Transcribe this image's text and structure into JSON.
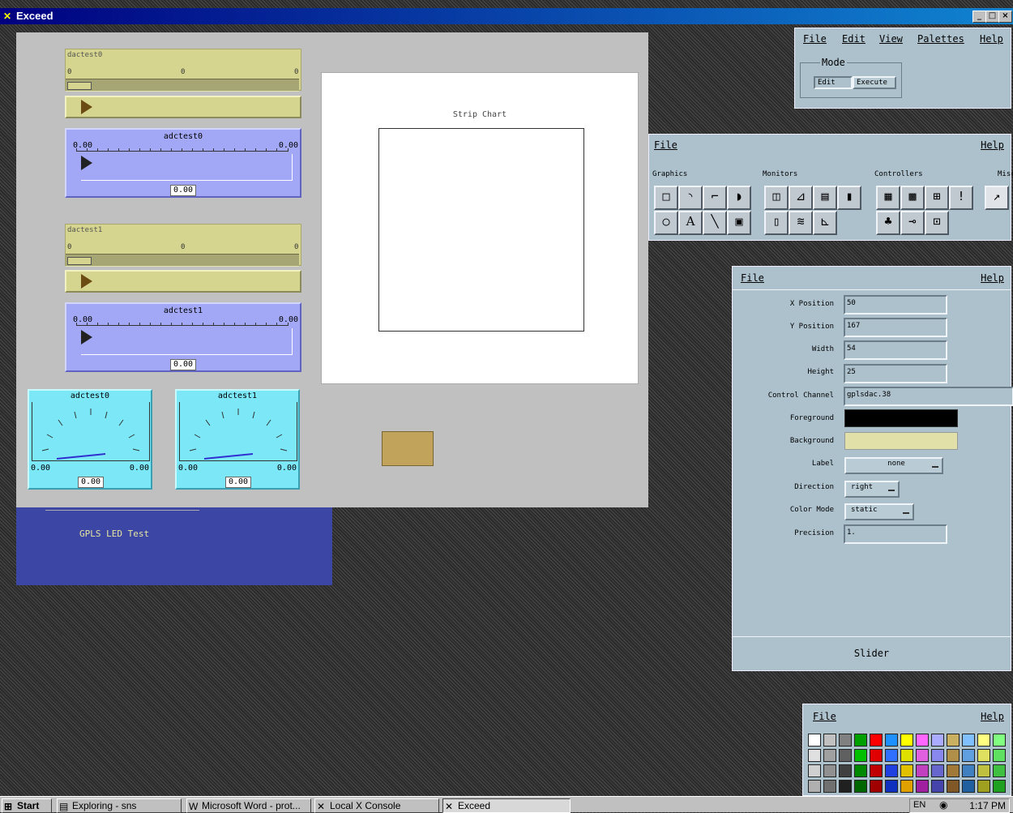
{
  "window": {
    "title": "Exceed",
    "app_icon": "x-icon",
    "min": "_",
    "max": "□",
    "close": "×"
  },
  "dacs": [
    {
      "name": "dactest0",
      "tick_left": "0",
      "tick_mid": "0",
      "tick_right": "0"
    },
    {
      "name": "dactest1",
      "tick_left": "0",
      "tick_mid": "0",
      "tick_right": "0"
    }
  ],
  "adcs": [
    {
      "name": "adctest0",
      "min": "0.00",
      "max": "0.00",
      "value": "0.00"
    },
    {
      "name": "adctest1",
      "min": "0.00",
      "max": "0.00",
      "value": "0.00"
    }
  ],
  "meters": [
    {
      "name": "adctest0",
      "min": "0.00",
      "max": "0.00",
      "value": "0.00"
    },
    {
      "name": "adctest1",
      "min": "0.00",
      "max": "0.00",
      "value": "0.00"
    }
  ],
  "strip_chart": {
    "title": "Strip Chart"
  },
  "led_panel": {
    "label": "GPLS LED Test"
  },
  "mode_window": {
    "menu": [
      "File",
      "Edit",
      "View",
      "Palettes",
      "Help"
    ],
    "group_label": "Mode",
    "edit_label": "Edit",
    "execute_label": "Execute"
  },
  "palette_window": {
    "file": "File",
    "help": "Help",
    "groups": {
      "graphics": "Graphics",
      "monitors": "Monitors",
      "controllers": "Controllers",
      "misc": "Misc"
    },
    "text_tool_glyph": "A"
  },
  "properties_window": {
    "file": "File",
    "help": "Help",
    "fields": [
      {
        "label": "X Position",
        "value": "50"
      },
      {
        "label": "Y Position",
        "value": "167"
      },
      {
        "label": "Width",
        "value": "54"
      },
      {
        "label": "Height",
        "value": "25"
      },
      {
        "label": "Control Channel",
        "value": "gplsdac.38"
      }
    ],
    "foreground_label": "Foreground",
    "background_label": "Background",
    "foreground_color": "#000000",
    "background_color": "#e0e0a8",
    "options": [
      {
        "label": "Label",
        "value": "none"
      },
      {
        "label": "Direction",
        "value": "right"
      },
      {
        "label": "Color Mode",
        "value": "static"
      }
    ],
    "precision_label": "Precision",
    "precision_value": "1.",
    "footer": "Slider"
  },
  "color_window": {
    "file": "File",
    "help": "Help",
    "colors": [
      "#ffffff",
      "#c0c0c0",
      "#808080",
      "#00a000",
      "#ff0000",
      "#1e90ff",
      "#ffff00",
      "#ff66ff",
      "#aaaaff",
      "#c8b060",
      "#80c0ff",
      "#ffff80",
      "#80ff80",
      "#e0e0e0",
      "#a0a0a0",
      "#606060",
      "#00c000",
      "#e00000",
      "#3070ff",
      "#e0e000",
      "#e060e0",
      "#8888ee",
      "#b09048",
      "#60a0e0",
      "#e0e060",
      "#60e060",
      "#d0d0d0",
      "#909090",
      "#404040",
      "#008800",
      "#c00000",
      "#2040e0",
      "#e0c000",
      "#c040c0",
      "#6666cc",
      "#a07838",
      "#4080c0",
      "#c0c040",
      "#40c040",
      "#b0b0b0",
      "#707070",
      "#202020",
      "#006600",
      "#a00000",
      "#1030c0",
      "#e0a000",
      "#a020a0",
      "#4444aa",
      "#805828",
      "#2060a0",
      "#a0a020",
      "#20a020"
    ]
  },
  "taskbar": {
    "start": "Start",
    "items": [
      "Exploring - sns",
      "Microsoft Word - prot...",
      "Local X Console",
      "Exceed"
    ],
    "clock": "1:17 PM"
  }
}
